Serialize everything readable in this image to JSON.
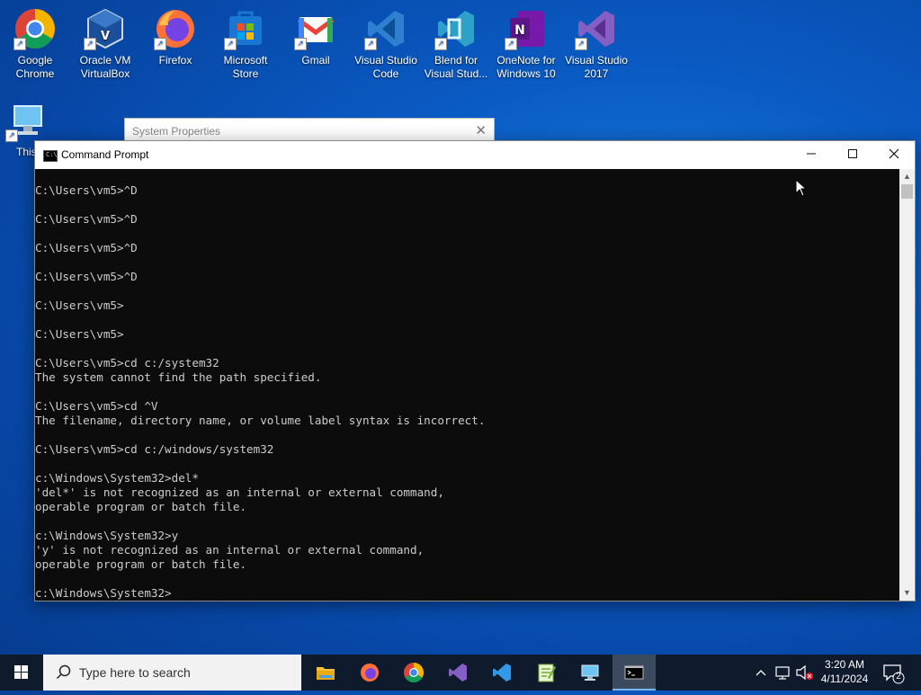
{
  "desktop": {
    "icons": [
      {
        "label_l1": "Google",
        "label_l2": "Chrome"
      },
      {
        "label_l1": "Oracle VM",
        "label_l2": "VirtualBox"
      },
      {
        "label_l1": "Firefox",
        "label_l2": ""
      },
      {
        "label_l1": "Microsoft",
        "label_l2": "Store"
      },
      {
        "label_l1": "Gmail",
        "label_l2": ""
      },
      {
        "label_l1": "Visual Studio",
        "label_l2": "Code"
      },
      {
        "label_l1": "Blend for",
        "label_l2": "Visual Stud..."
      },
      {
        "label_l1": "OneNote for",
        "label_l2": "Windows 10"
      },
      {
        "label_l1": "Visual Studio",
        "label_l2": "2017"
      },
      {
        "label_l1": "This",
        "label_l2": ""
      }
    ]
  },
  "background_window": {
    "title": "System Properties"
  },
  "cmd": {
    "title": "Command Prompt",
    "lines": [
      "C:\\Users\\vm5>^D",
      "",
      "C:\\Users\\vm5>^D",
      "",
      "C:\\Users\\vm5>^D",
      "",
      "C:\\Users\\vm5>^D",
      "",
      "C:\\Users\\vm5>",
      "",
      "C:\\Users\\vm5>",
      "",
      "C:\\Users\\vm5>cd c:/system32",
      "The system cannot find the path specified.",
      "",
      "C:\\Users\\vm5>cd ^V",
      "The filename, directory name, or volume label syntax is incorrect.",
      "",
      "C:\\Users\\vm5>cd c:/windows/system32",
      "",
      "c:\\Windows\\System32>del*",
      "'del*' is not recognized as an internal or external command,",
      "operable program or batch file.",
      "",
      "c:\\Windows\\System32>y",
      "'y' is not recognized as an internal or external command,",
      "operable program or batch file.",
      "",
      "c:\\Windows\\System32>"
    ]
  },
  "taskbar": {
    "search_placeholder": "Type here to search",
    "time": "3:20 AM",
    "date": "4/11/2024",
    "notification_count": "2"
  },
  "colors": {
    "taskbar": "#0f1b2d",
    "console_bg": "#0c0c0c",
    "console_fg": "#cccccc"
  }
}
